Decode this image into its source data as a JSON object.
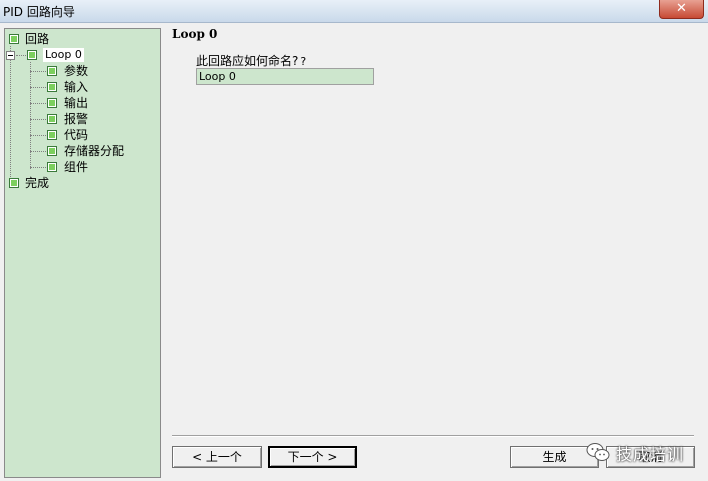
{
  "window": {
    "title": "PID 回路向导",
    "close_icon": "close-icon"
  },
  "tree": {
    "root": {
      "label": "回路",
      "icon": "green-square-icon"
    },
    "loop": {
      "label": "Loop 0",
      "icon": "green-square-icon",
      "expander": "minus"
    },
    "children": [
      {
        "label": "参数"
      },
      {
        "label": "输入"
      },
      {
        "label": "输出"
      },
      {
        "label": "报警"
      },
      {
        "label": "代码"
      },
      {
        "label": "存储器分配"
      },
      {
        "label": "组件"
      }
    ],
    "finish": {
      "label": "完成"
    }
  },
  "content": {
    "heading": "Loop 0",
    "question": "此回路应如何命名?",
    "help_mark": "?",
    "name_value": "Loop 0"
  },
  "buttons": {
    "prev": "< 上一个",
    "next": "下一个 >",
    "generate": "生成",
    "cancel": "取消"
  },
  "watermark": {
    "text": "技成培训",
    "icon": "wechat-icon"
  },
  "colors": {
    "tree_bg": "#cde6cd",
    "node_green": "#7ccf5e",
    "input_bg": "#cde6cd"
  }
}
